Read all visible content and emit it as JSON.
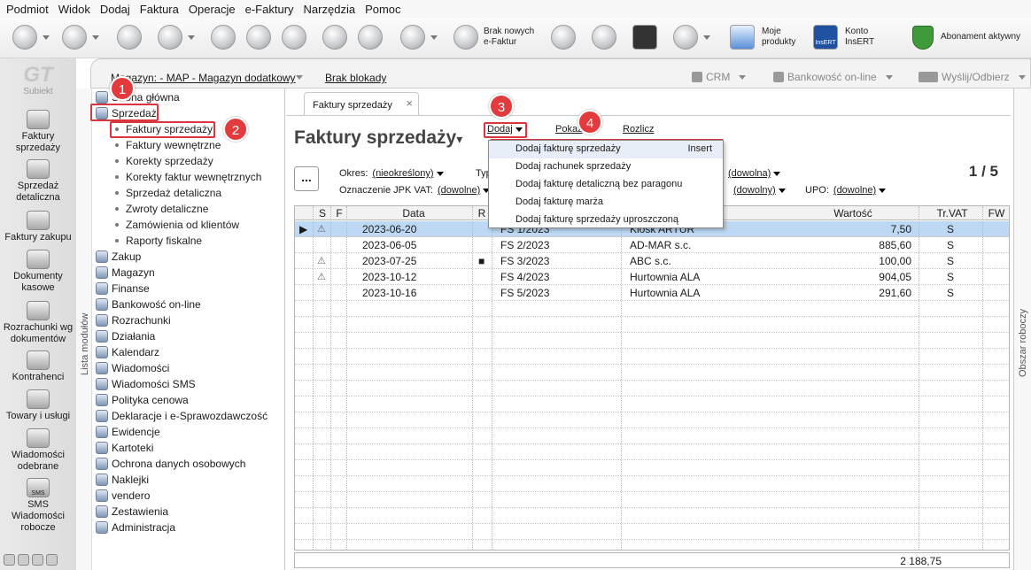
{
  "menu": [
    "Podmiot",
    "Widok",
    "Dodaj",
    "Faktura",
    "Operacje",
    "e-Faktury",
    "Narzędzia",
    "Pomoc"
  ],
  "toolbar": {
    "efaktur_label1": "Brak nowych",
    "efaktur_label2": "e-Faktur",
    "moje_label1": "Moje",
    "moje_label2": "produkty",
    "konto_label1": "Konto",
    "konto_label2": "InsERT",
    "insert_logo": "InsERT",
    "abonament_label": "Abonament aktywny"
  },
  "leftbar": {
    "logo_big": "GT",
    "logo_small": "Subiekt",
    "items": [
      {
        "label": "Faktury sprzedaży"
      },
      {
        "label": "Sprzedaż detaliczna"
      },
      {
        "label": "Faktury zakupu"
      },
      {
        "label": "Dokumenty kasowe"
      },
      {
        "label": "Rozrachunki wg dokumentów"
      },
      {
        "label": "Kontrahenci"
      },
      {
        "label": "Towary i usługi"
      },
      {
        "label": "Wiadomości odebrane"
      },
      {
        "label": "SMS Wiadomości robocze"
      }
    ],
    "sms_icon_label": "SMS"
  },
  "subbar": {
    "magazyn": "Magazyn: - MAP - Magazyn dodatkowy",
    "blokady": "Brak blokady",
    "crm": "CRM",
    "bank": "Bankowość on-line",
    "send": "Wyślij/Odbierz"
  },
  "modules": {
    "vertical_label": "Lista modułów",
    "home": "Strona główna",
    "sprzedaz": "Sprzedaż",
    "sprzedaz_sub": [
      "Faktury sprzedaży",
      "Faktury wewnętrzne",
      "Korekty sprzedaży",
      "Korekty faktur wewnętrznych",
      "Sprzedaż detaliczna",
      "Zwroty detaliczne",
      "Zamówienia od klientów",
      "Raporty fiskalne"
    ],
    "others": [
      "Zakup",
      "Magazyn",
      "Finanse",
      "Bankowość on-line",
      "Rozrachunki",
      "Działania",
      "Kalendarz",
      "Wiadomości",
      "Wiadomości SMS",
      "Polityka cenowa",
      "Deklaracje i e-Sprawozdawczość",
      "Ewidencje",
      "Kartoteki",
      "Ochrona danych osobowych",
      "Naklejki",
      "vendero",
      "Zestawienia",
      "Administracja"
    ]
  },
  "badges": [
    "1",
    "2",
    "3",
    "4"
  ],
  "content": {
    "tab_label": "Faktury sprzedaży",
    "tab_close": "×",
    "title": "Faktury sprzedaży",
    "title_arrow": "▾",
    "dodaj": "Dodaj",
    "pokaz": "Pokaż",
    "rozlicz": "Rozlicz",
    "more_btn": "...",
    "okres_label": "Okres:",
    "okres_value": "(nieokreślony)",
    "typ_label": "Typ:",
    "dowolna_value": "(dowolna)",
    "jpk_label": "Oznaczenie JPK VAT:",
    "jpk_value": "(dowolne)",
    "dowolny_value": "(dowolny)",
    "upo_label": "UPO:",
    "upo_value": "(dowolne)",
    "pages": "1 / 5",
    "columns": [
      "S",
      "F",
      "Data",
      "R",
      "Wartość",
      "Tr.VAT",
      "FW"
    ],
    "rows": [
      {
        "warn": "⚠",
        "date": "2023-06-20",
        "num": "FS 1/2023",
        "client": "Kiosk ARTUR",
        "value": "7,50",
        "vat": "S",
        "r": ""
      },
      {
        "warn": "",
        "date": "2023-06-05",
        "num": "FS 2/2023",
        "client": "AD-MAR s.c.",
        "value": "885,60",
        "vat": "S",
        "r": ""
      },
      {
        "warn": "⚠",
        "date": "2023-07-25",
        "num": "FS 3/2023",
        "client": "ABC s.c.",
        "value": "100,00",
        "vat": "S",
        "r": "■"
      },
      {
        "warn": "⚠",
        "date": "2023-10-12",
        "num": "FS 4/2023",
        "client": "Hurtownia ALA",
        "value": "904,05",
        "vat": "S",
        "r": ""
      },
      {
        "warn": "",
        "date": "2023-10-16",
        "num": "FS 5/2023",
        "client": "Hurtownia ALA",
        "value": "291,60",
        "vat": "S",
        "r": ""
      }
    ],
    "sum": "2 188,75"
  },
  "dropdown": {
    "items": [
      {
        "label": "Dodaj fakturę sprzedaży",
        "shortcut": "Insert"
      },
      {
        "label": "Dodaj rachunek sprzedaży",
        "shortcut": ""
      },
      {
        "label": "Dodaj fakturę detaliczną bez paragonu",
        "shortcut": ""
      },
      {
        "label": "Dodaj fakturę marża",
        "shortcut": ""
      },
      {
        "label": "Dodaj fakturę sprzedaży uproszczoną",
        "shortcut": ""
      }
    ]
  },
  "rightbar_label": "Obszar roboczy",
  "colors": {
    "highlight": "#d9363e",
    "selected_row": "#bcd8f2",
    "badge": "#e33a3d"
  }
}
